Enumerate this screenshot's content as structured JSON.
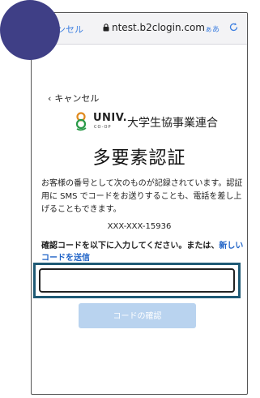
{
  "browser": {
    "cancel_label": "ャンセル",
    "url": "ntest.b2clogin.com",
    "text_size_label": "ぁあ",
    "lock_icon": "lock-icon",
    "reload_icon": "reload-icon"
  },
  "page": {
    "back_label": "キャンセル",
    "logo": {
      "word": "UNIV.",
      "sub": "CO-OP"
    },
    "org_name": "大学生協事業連合",
    "title": "多要素認証",
    "description": "お客様の番号として次のものが記録されています。認証用に SMS でコードをお送りすることも、電話を差し上げることもできます。",
    "masked_phone": "XXX-XXX-15936",
    "prompt": "確認コードを以下に入力してください。または、",
    "new_code_link": "新しいコードを送信",
    "code_input_value": "",
    "verify_button": "コードの確認"
  },
  "colors": {
    "avatar": "#3f3f86",
    "link": "#1f63c7",
    "focus_frame": "#1f5a75",
    "button_disabled": "#b9d3ef"
  }
}
